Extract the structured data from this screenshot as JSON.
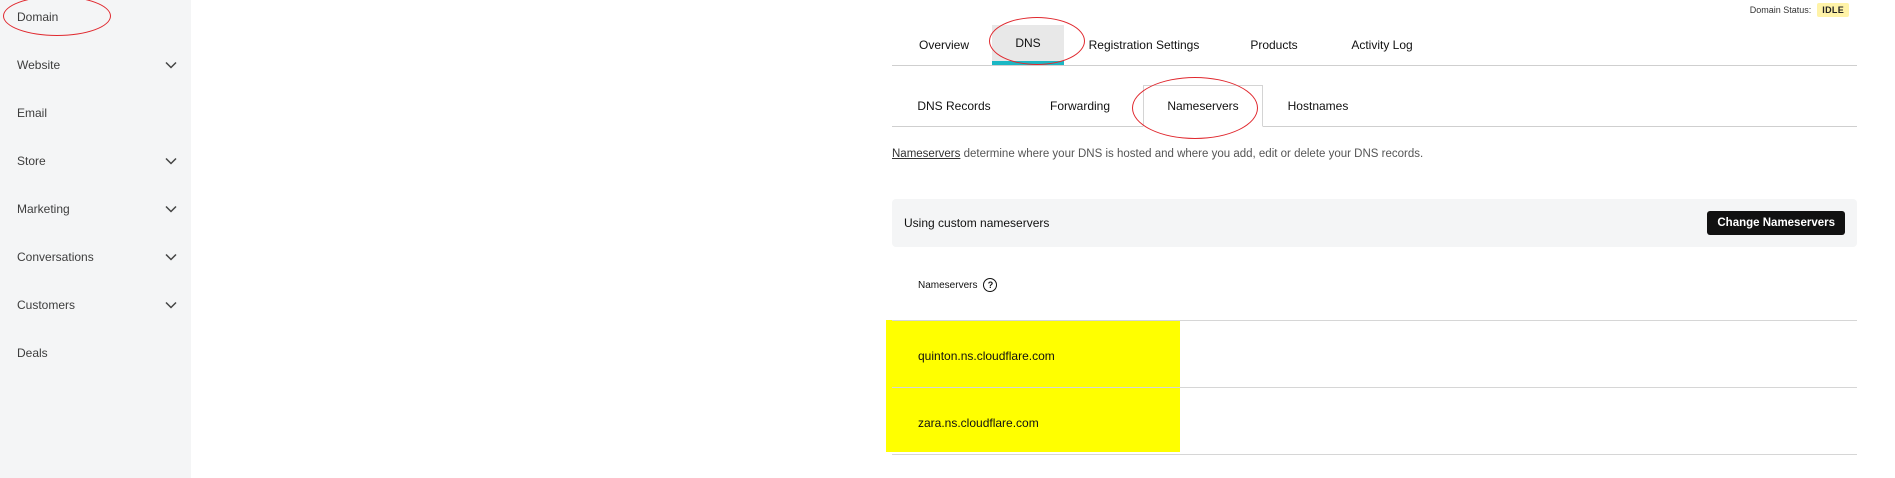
{
  "sidebar": {
    "items": [
      {
        "label": "Domain",
        "has_chevron": false
      },
      {
        "label": "Website",
        "has_chevron": true
      },
      {
        "label": "Email",
        "has_chevron": false
      },
      {
        "label": "Store",
        "has_chevron": true
      },
      {
        "label": "Marketing",
        "has_chevron": true
      },
      {
        "label": "Conversations",
        "has_chevron": true
      },
      {
        "label": "Customers",
        "has_chevron": true
      },
      {
        "label": "Deals",
        "has_chevron": false
      }
    ]
  },
  "status": {
    "label": "Domain Status:",
    "value": "IDLE"
  },
  "tabs": {
    "top": [
      "Overview",
      "DNS",
      "Registration Settings",
      "Products",
      "Activity Log"
    ],
    "top_active": "DNS",
    "sub": [
      "DNS Records",
      "Forwarding",
      "Nameservers",
      "Hostnames"
    ],
    "sub_active": "Nameservers"
  },
  "description": {
    "link": "Nameservers",
    "text": " determine where your DNS is hosted and where you add, edit or delete your DNS records."
  },
  "panel": {
    "text": "Using custom nameservers",
    "button_label": "Change Nameservers"
  },
  "nameservers": {
    "header": "Nameservers",
    "help_icon": "question-circle-icon",
    "list": [
      "quinton.ns.cloudflare.com",
      "zara.ns.cloudflare.com"
    ]
  },
  "colors": {
    "accent": "#1bb7c4",
    "annotation": "#e0282e",
    "highlight": "#ffff00",
    "sidebar_bg": "#f4f5f6"
  }
}
